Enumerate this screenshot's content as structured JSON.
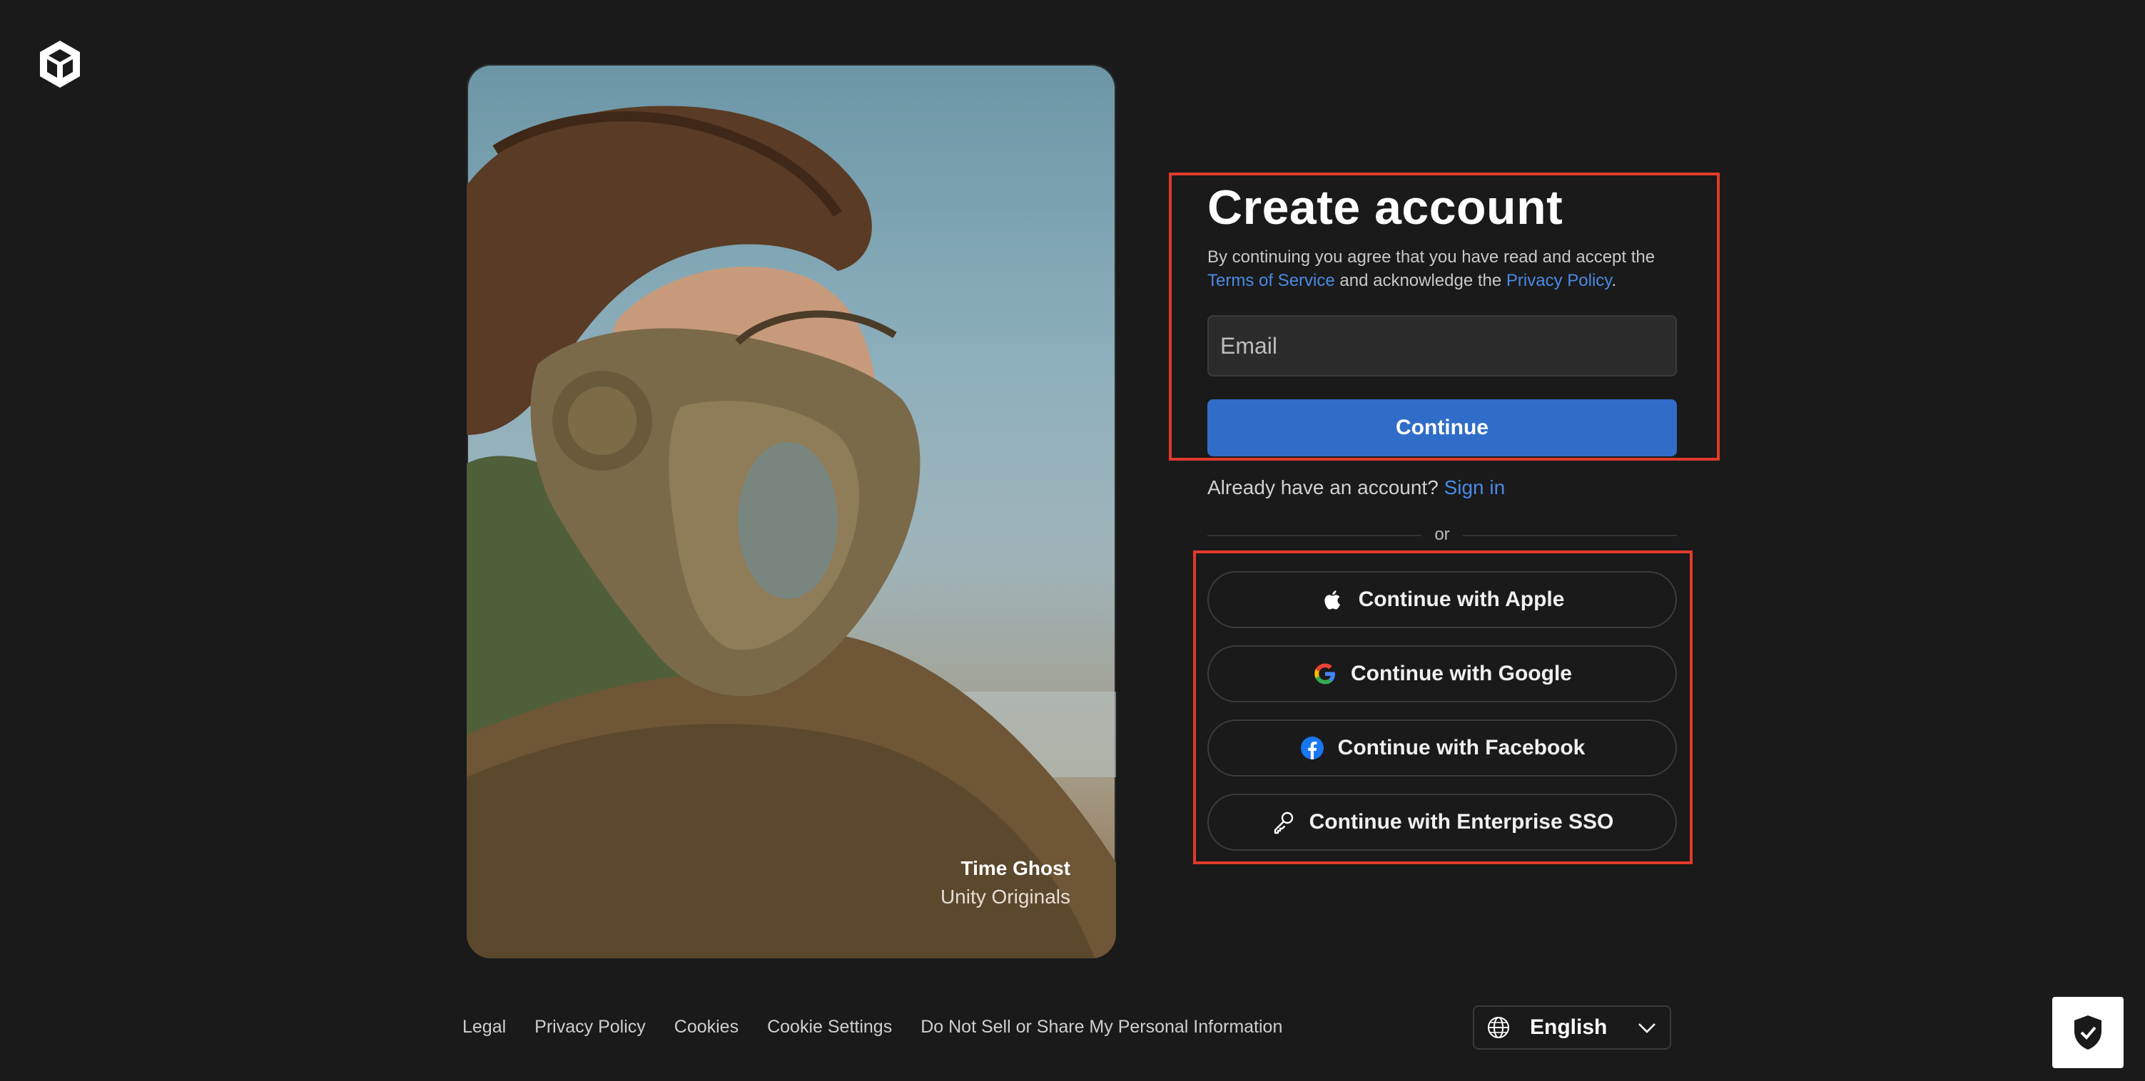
{
  "logo": {
    "icon": "unity-logo-icon"
  },
  "hero": {
    "title": "Time Ghost",
    "subtitle": "Unity Originals"
  },
  "form": {
    "heading": "Create account",
    "legal_prefix": "By continuing you agree that you have read and accept the ",
    "terms_link": "Terms of Service",
    "legal_middle": " and acknowledge the ",
    "privacy_link": "Privacy Policy",
    "legal_suffix": ".",
    "email_placeholder": "Email",
    "continue_label": "Continue",
    "signin_prompt": "Already have an account? ",
    "signin_link": "Sign in",
    "or_label": "or"
  },
  "sso": [
    {
      "label": "Continue with Apple",
      "icon": "apple-icon"
    },
    {
      "label": "Continue with Google",
      "icon": "google-icon"
    },
    {
      "label": "Continue with Facebook",
      "icon": "facebook-icon"
    },
    {
      "label": "Continue with Enterprise SSO",
      "icon": "key-icon"
    }
  ],
  "footer": {
    "links": [
      "Legal",
      "Privacy Policy",
      "Cookies",
      "Cookie Settings",
      "Do Not Sell or Share My Personal Information"
    ],
    "language": "English"
  },
  "colors": {
    "background": "#1a1a1a",
    "primary": "#306dc9",
    "link": "#4a8ae6",
    "annotation": "#e23a2a"
  }
}
